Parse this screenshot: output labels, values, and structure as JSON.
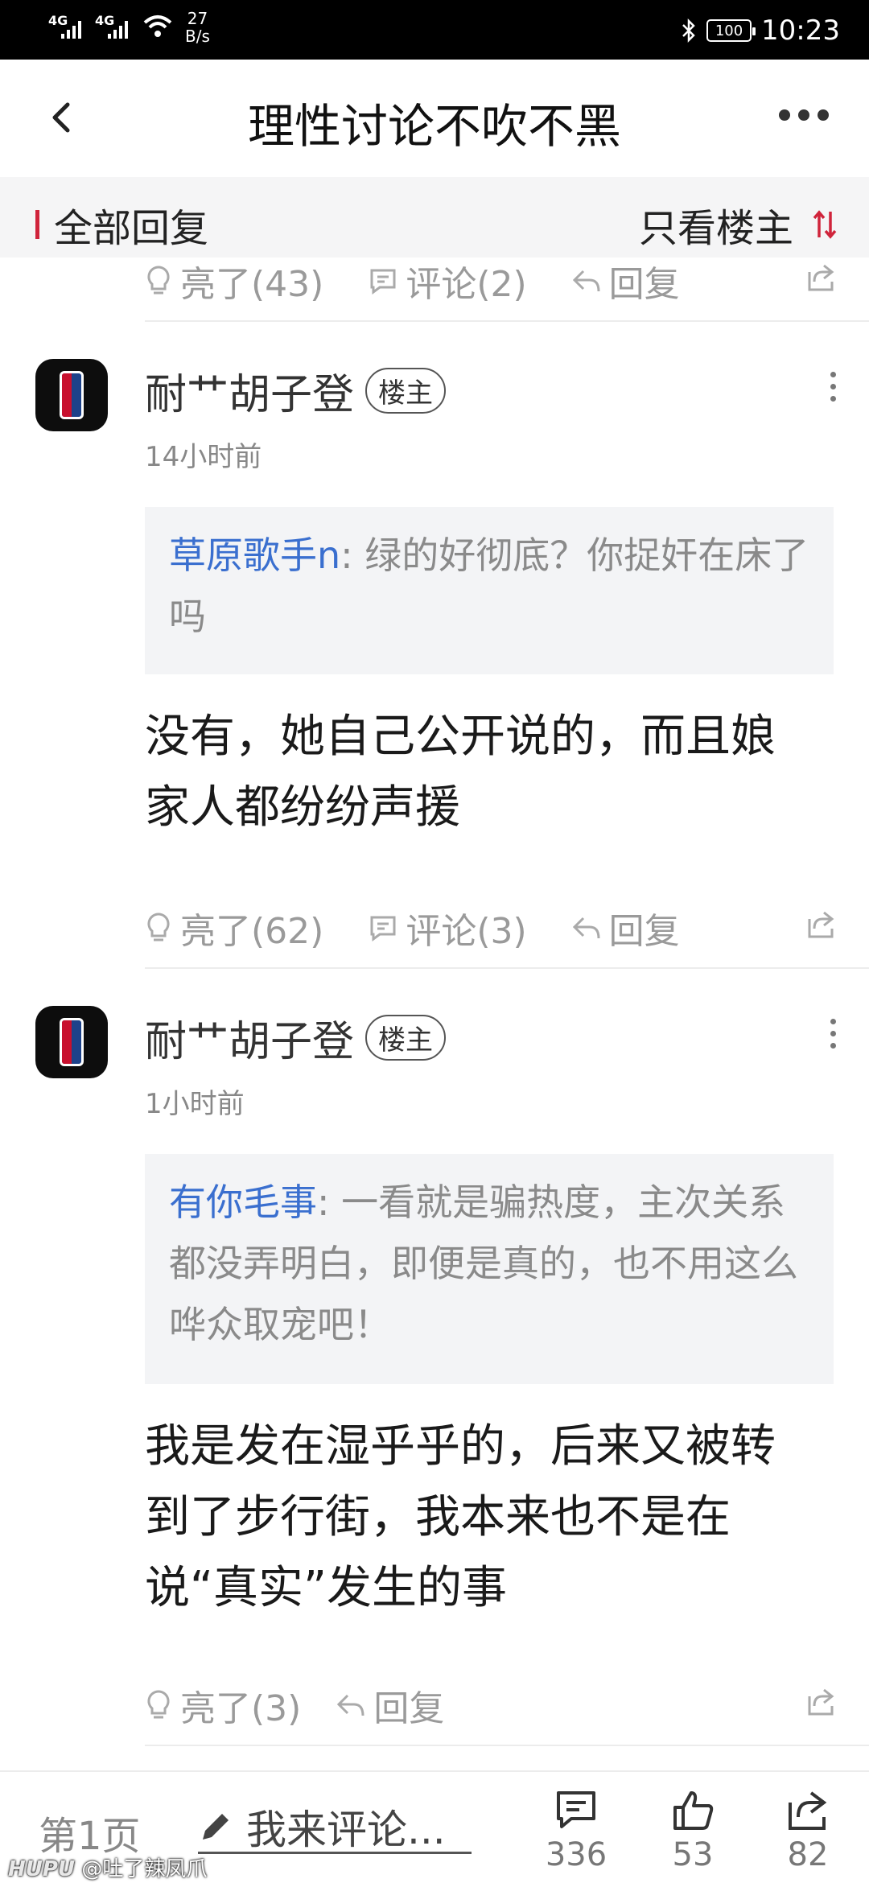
{
  "status_bar": {
    "network_1": "4G",
    "network_2": "4G",
    "speed_value": "27",
    "speed_unit": "B/s",
    "battery": "100",
    "time": "10:23"
  },
  "header": {
    "title": "理性讨论不吹不黑",
    "back_icon": "chevron-left-icon",
    "more_icon": "more-horizontal-icon"
  },
  "filter": {
    "all_replies": "全部回复",
    "op_only": "只看楼主"
  },
  "top_actions": {
    "like": "亮了(43)",
    "comment": "评论(2)",
    "reply": "回复"
  },
  "posts": [
    {
      "user": "耐艹胡子登",
      "badge": "楼主",
      "time": "14小时前",
      "quote_user": "草原歌手n",
      "quote_text": ": 绿的好彻底？你捉奸在床了吗",
      "content": "没有，她自己公开说的，而且娘家人都纷纷声援",
      "like": "亮了(62)",
      "comment": "评论(3)",
      "reply": "回复"
    },
    {
      "user": "耐艹胡子登",
      "badge": "楼主",
      "time": "1小时前",
      "quote_user": "有你毛事",
      "quote_text": ": 一看就是骗热度，主次关系都没弄明白，即便是真的，也不用这么哗众取宠吧！",
      "content": "我是发在湿乎乎的，后来又被转到了步行街，我本来也不是在说“真实”发生的事",
      "like": "亮了(3)",
      "reply": "回复"
    }
  ],
  "bottom_bar": {
    "page": "第1页",
    "comment_placeholder": "我来评论...",
    "comments_count": "336",
    "likes_count": "53",
    "shares_count": "82"
  },
  "watermark": {
    "brand": "HUPU",
    "user": "@吐了辣凤爪"
  },
  "colors": {
    "accent_red": "#d0243b",
    "quote_user_blue": "#3a6fcf",
    "muted_gray": "#9a9a9a"
  }
}
